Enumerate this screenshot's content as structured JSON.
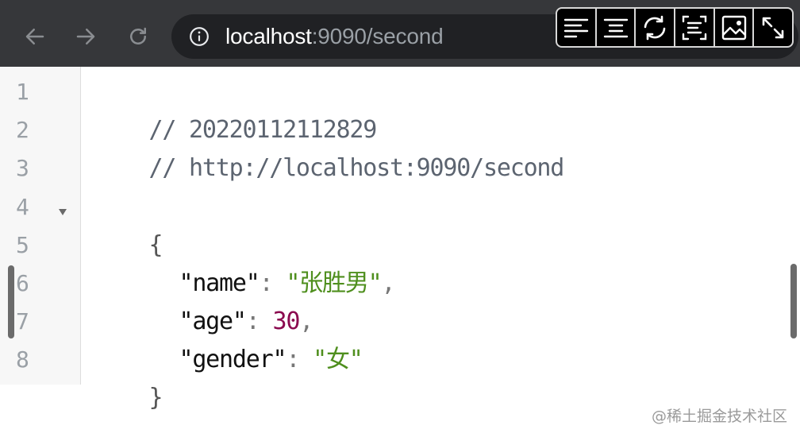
{
  "browser": {
    "url_host": "localhost",
    "url_path": ":9090/second",
    "nav_icons": [
      "back-arrow-icon",
      "forward-arrow-icon",
      "reload-icon",
      "info-icon"
    ],
    "ext_actions": [
      {
        "name": "align-left-icon"
      },
      {
        "name": "align-center-icon"
      },
      {
        "name": "refresh-icon"
      },
      {
        "name": "scan-text-icon"
      },
      {
        "name": "image-icon"
      },
      {
        "name": "expand-icon"
      }
    ]
  },
  "viewer": {
    "line_numbers": [
      "1",
      "2",
      "3",
      "4",
      "5",
      "6",
      "7",
      "8"
    ],
    "comment_1": "// 20220112112829",
    "comment_2": "// http://localhost:9090/second",
    "open_brace": "{",
    "close_brace": "}",
    "fields": [
      {
        "key": "\"name\"",
        "colon": ": ",
        "value": "\"张胜男\"",
        "trail": ","
      },
      {
        "key": "\"age\"",
        "colon": ": ",
        "value": "30",
        "trail": ","
      },
      {
        "key": "\"gender\"",
        "colon": ": ",
        "value": "\"女\"",
        "trail": ""
      }
    ]
  },
  "watermark": "@稀土掘金技术社区",
  "colors": {
    "toolbar_bg": "#36373a",
    "omnibox_bg": "#202124",
    "string": "#4f8f1e",
    "number": "#8b0a4f"
  }
}
